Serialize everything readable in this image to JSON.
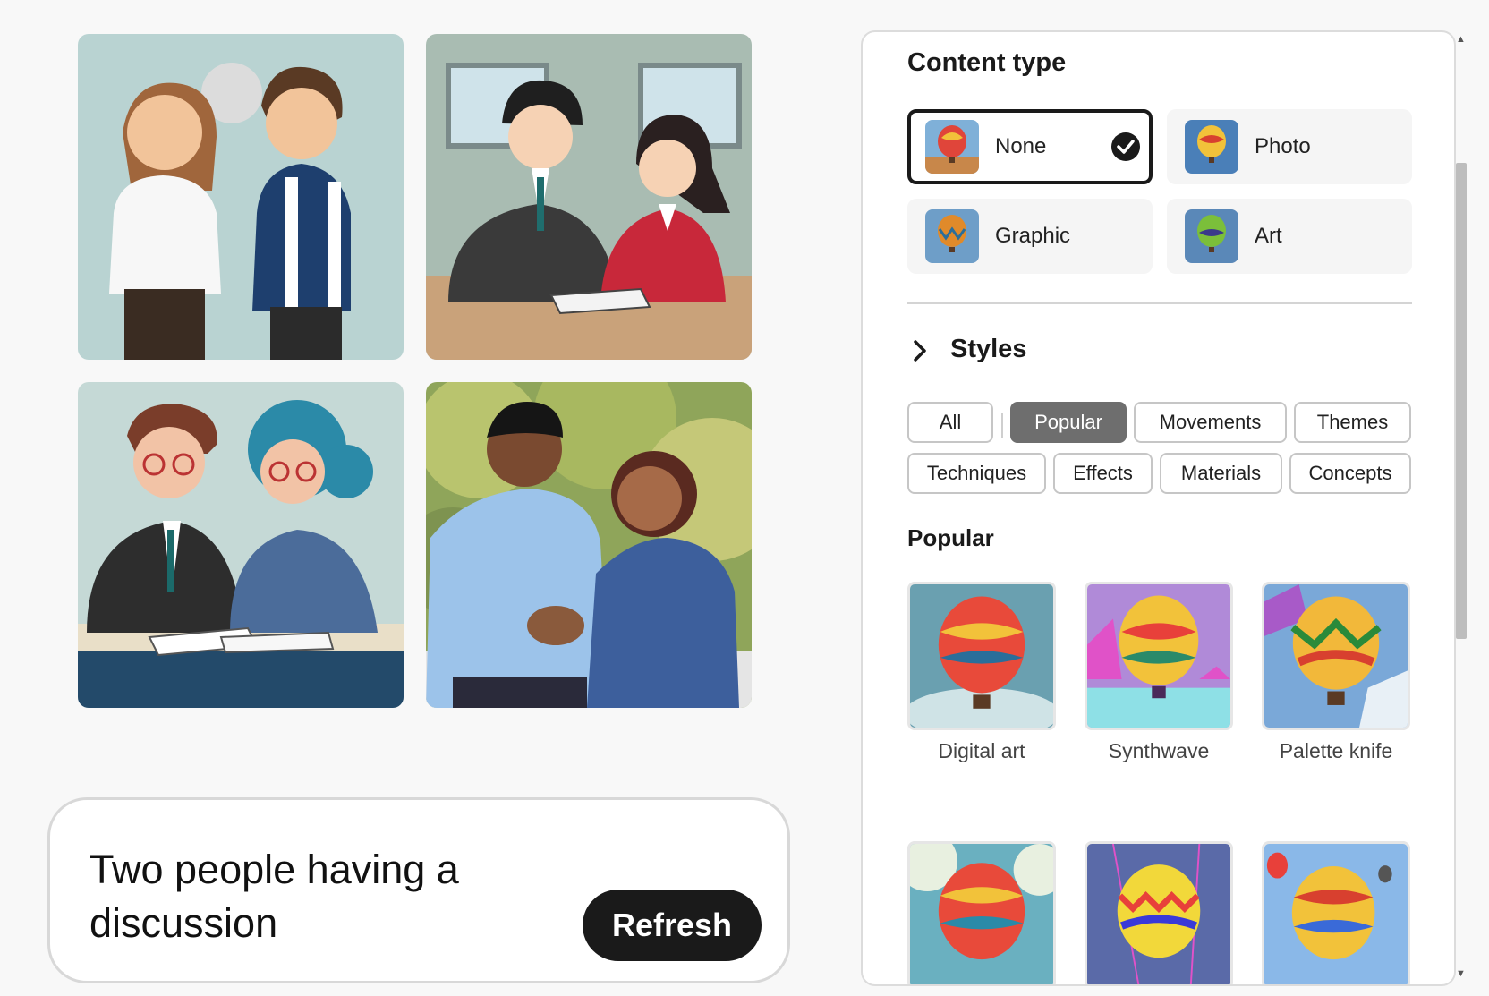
{
  "prompt": {
    "text": "Two people having a discussion",
    "refresh_label": "Refresh"
  },
  "images": [
    {
      "name": "cartoon-two-people-talking"
    },
    {
      "name": "cartoon-office-meeting"
    },
    {
      "name": "cartoon-people-signing"
    },
    {
      "name": "photo-two-people-handshake"
    }
  ],
  "panel": {
    "content_type": {
      "title": "Content type",
      "options": [
        {
          "label": "None",
          "selected": true
        },
        {
          "label": "Photo",
          "selected": false
        },
        {
          "label": "Graphic",
          "selected": false
        },
        {
          "label": "Art",
          "selected": false
        }
      ]
    },
    "styles": {
      "title": "Styles",
      "chips": [
        {
          "label": "All",
          "active": false
        },
        {
          "label": "Popular",
          "active": true
        },
        {
          "label": "Movements",
          "active": false
        },
        {
          "label": "Themes",
          "active": false
        },
        {
          "label": "Techniques",
          "active": false
        },
        {
          "label": "Effects",
          "active": false
        },
        {
          "label": "Materials",
          "active": false
        },
        {
          "label": "Concepts",
          "active": false
        }
      ]
    },
    "popular": {
      "title": "Popular",
      "items": [
        {
          "label": "Digital art"
        },
        {
          "label": "Synthwave"
        },
        {
          "label": "Palette knife"
        }
      ]
    }
  },
  "colors": {
    "accent": "#1a1a1a",
    "chip_active": "#6e6e6e"
  }
}
